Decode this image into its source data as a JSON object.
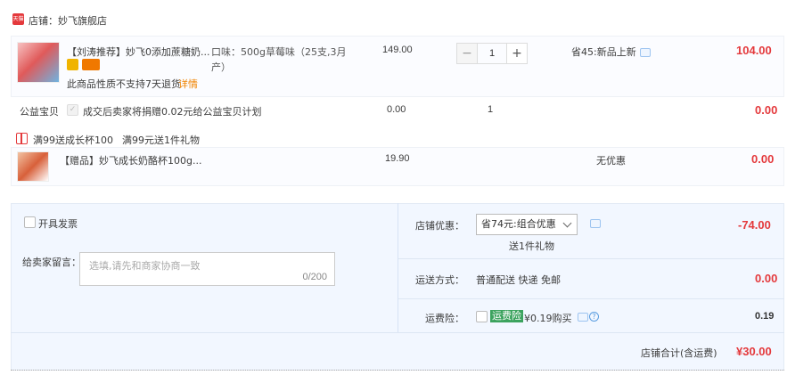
{
  "shop": {
    "badge": "天猫",
    "label": "店铺：妙飞旗舰店"
  },
  "product": {
    "title": "【刘涛推荐】妙飞0添加蔗糖奶...",
    "spec_line1": "口味：500g草莓味（25支,3月",
    "spec_line2": "产）",
    "price": "149.00",
    "quantity": "1",
    "promo": "省45:新品上新",
    "subtotal": "104.00",
    "no_return": "此商品性质不支持7天退货",
    "detail_link": "详情"
  },
  "charity": {
    "label": "公益宝贝",
    "text": "成交后卖家将捐赠0.02元给公益宝贝计划",
    "price": "0.00",
    "quantity": "1",
    "subtotal": "0.00"
  },
  "gift_promo": {
    "text1": "满99送成长杯100",
    "text2": "满99元送1件礼物"
  },
  "gift": {
    "title": "【赠品】妙飞成长奶酪杯100g...",
    "price": "19.90",
    "discount": "无优惠",
    "subtotal": "0.00"
  },
  "invoice": {
    "label": "开具发票"
  },
  "message": {
    "label": "给卖家留言：",
    "placeholder": "选填,请先和商家协商一致",
    "count": "0/200"
  },
  "shop_discount": {
    "label": "店铺优惠：",
    "selected": "省74元:组合优惠",
    "note": "送1件礼物",
    "amount": "-74.00"
  },
  "shipping": {
    "label": "运送方式：",
    "value": "普通配送 快递 免邮",
    "amount": "0.00"
  },
  "insurance": {
    "label": "运费险：",
    "tag": "运费险",
    "price": "¥0.19购买",
    "amount": "0.19"
  },
  "total": {
    "label": "店铺合计(含运费)",
    "amount": "¥30.00"
  },
  "colors": {
    "accent": "#e4393c",
    "panel": "#f2f7ff",
    "link": "#f08300",
    "insurance_tag": "#3ca35e"
  }
}
